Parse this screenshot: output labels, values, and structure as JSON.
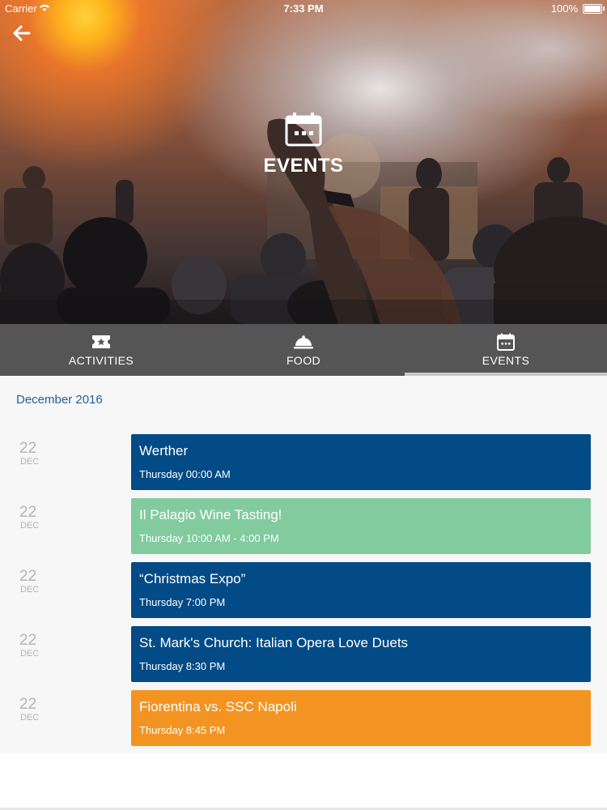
{
  "status_bar": {
    "carrier": "Carrier",
    "time": "7:33 PM",
    "battery": "100%"
  },
  "hero": {
    "title": "EVENTS",
    "icon": "calendar-icon"
  },
  "tabs": [
    {
      "label": "ACTIVITIES",
      "icon": "ticket-icon",
      "active": false
    },
    {
      "label": "FOOD",
      "icon": "cloche-icon",
      "active": false
    },
    {
      "label": "EVENTS",
      "icon": "calendar-icon",
      "active": true
    }
  ],
  "month_header": "December 2016",
  "events": [
    {
      "day": "22",
      "month": "DEC",
      "title": "Werther",
      "time": "Thursday 00:00 AM",
      "color": "#034b87"
    },
    {
      "day": "22",
      "month": "DEC",
      "title": "Il Palagio Wine Tasting!",
      "time": "Thursday 10:00 AM - 4:00 PM",
      "color": "#82cb9f"
    },
    {
      "day": "22",
      "month": "DEC",
      "title": "“Christmas Expo”",
      "time": "Thursday 7:00 PM",
      "color": "#034b87"
    },
    {
      "day": "22",
      "month": "DEC",
      "title": "St. Mark's Church: Italian Opera Love Duets",
      "time": "Thursday 8:30 PM",
      "color": "#034b87"
    },
    {
      "day": "22",
      "month": "DEC",
      "title": "Fiorentina vs. SSC Napoli",
      "time": "Thursday 8:45 PM",
      "color": "#f39422"
    }
  ],
  "colors": {
    "tab_bar": "#555555",
    "accent_blue": "#034b87",
    "month_text": "#1f5f97"
  }
}
